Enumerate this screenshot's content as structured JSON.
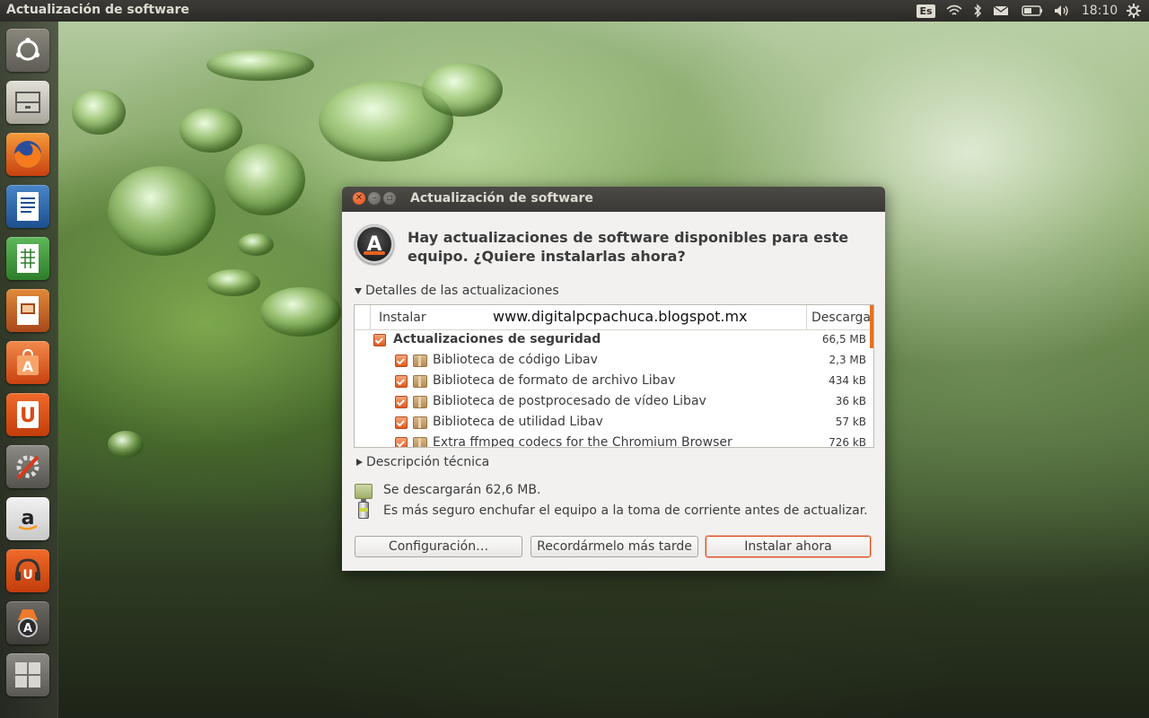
{
  "top_panel": {
    "app_title": "Actualización de software",
    "keyboard_layout": "Es",
    "clock": "18:10",
    "icons": [
      "wifi-icon",
      "bluetooth-icon",
      "mail-icon",
      "battery-icon",
      "volume-icon",
      "settings-gear-icon"
    ]
  },
  "launcher": {
    "items": [
      "ubuntu-dash",
      "files",
      "firefox",
      "libreoffice-writer",
      "libreoffice-calc",
      "libreoffice-impress",
      "ubuntu-software-center",
      "ubuntu-one",
      "system-settings",
      "amazon",
      "ubuntu-one-music",
      "software-updater",
      "workspace-switcher"
    ]
  },
  "dialog": {
    "title": "Actualización de software",
    "question": "Hay actualizaciones de software disponibles para este equipo. ¿Quiere instalarlas ahora?",
    "details_expander": "Detalles de las actualizaciones",
    "list": {
      "col_install": "Instalar",
      "col_download": "Descarga",
      "watermark": "www.digitalpcpachuca.blogspot.mx",
      "group": {
        "label": "Actualizaciones de seguridad",
        "size": "66,5 MB",
        "checked": true
      },
      "items": [
        {
          "label": "Biblioteca de código Libav",
          "size": "2,3 MB",
          "checked": true
        },
        {
          "label": "Biblioteca de formato de archivo Libav",
          "size": "434 kB",
          "checked": true
        },
        {
          "label": "Biblioteca de postprocesado de vídeo Libav",
          "size": "36 kB",
          "checked": true
        },
        {
          "label": "Biblioteca de utilidad Libav",
          "size": "57 kB",
          "checked": true
        },
        {
          "label": "Extra ffmpeg codecs for the Chromium Browser",
          "size": "726 kB",
          "checked": true
        }
      ]
    },
    "tech_expander": "Descripción técnica",
    "download_info": "Se descargarán 62,6 MB.",
    "power_info": "Es más seguro enchufar el equipo a la toma de corriente antes de actualizar.",
    "buttons": {
      "config": "Configuración…",
      "later": "Recordármelo más tarde",
      "install": "Instalar ahora"
    },
    "accent_color": "#dd4814"
  }
}
